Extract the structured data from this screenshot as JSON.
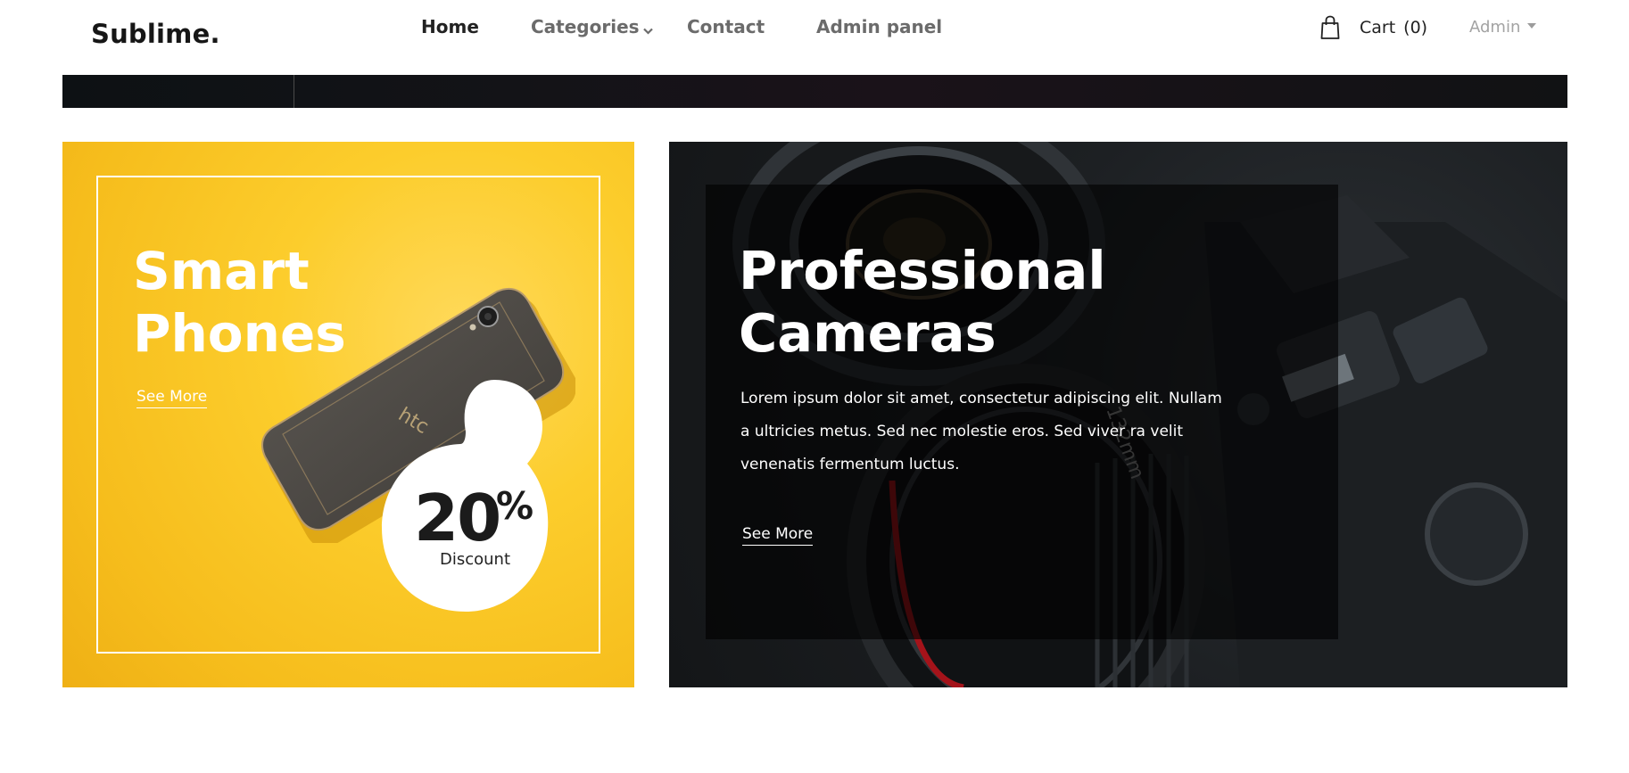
{
  "header": {
    "logo": "Sublime.",
    "nav": {
      "home": "Home",
      "categories": "Categories",
      "contact": "Contact",
      "admin_panel": "Admin panel"
    },
    "cart_label": "Cart",
    "cart_count": "(0)",
    "user_menu": "Admin"
  },
  "banners": {
    "phones": {
      "title": "Smart\nPhones",
      "link": "See More",
      "brand_on_phone": "htc",
      "discount_value": "20",
      "discount_symbol": "%",
      "discount_label": "Discount",
      "bg_color": "#fccd2c"
    },
    "cameras": {
      "title": "Professional\nCameras",
      "description": "Lorem ipsum dolor sit amet, consectetur adipiscing elit. Nullam a ultricies metus. Sed nec molestie eros. Sed viver ra velit venenatis fermentum luctus.",
      "link": "See More",
      "lens_text": "132mm",
      "bg_color": "#1d2023"
    }
  },
  "icons": {
    "cart": "shopping-bag-icon",
    "categories_caret": "chevron-down-icon",
    "user_caret": "caret-down-icon"
  }
}
